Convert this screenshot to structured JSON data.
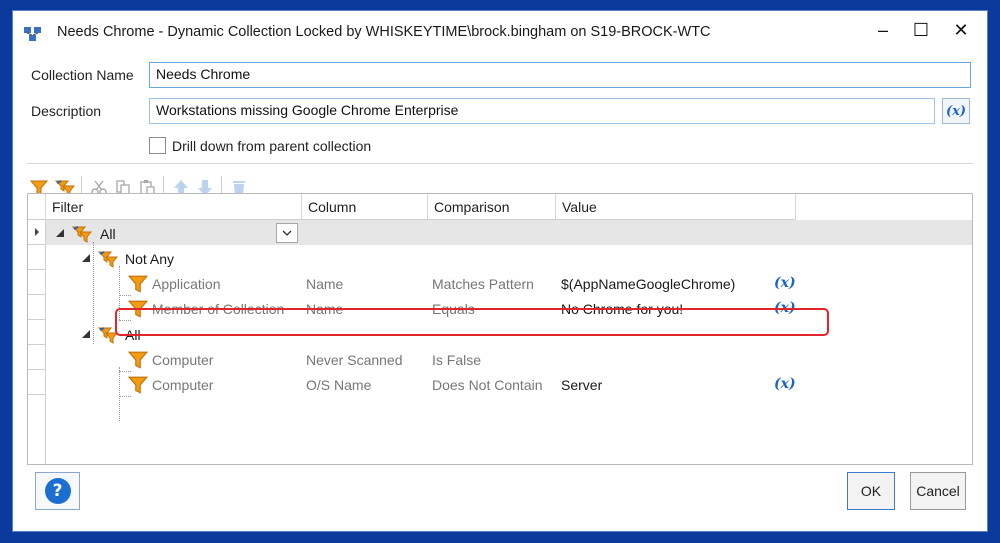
{
  "window": {
    "title": "Needs Chrome - Dynamic Collection Locked by WHISKEYTIME\\brock.bingham on S19-BROCK-WTC",
    "minimize": "–",
    "maximize": "☐",
    "close": "✕"
  },
  "form": {
    "collection_name_label": "Collection Name",
    "collection_name_value": "Needs Chrome",
    "description_label": "Description",
    "description_value": "Workstations missing Google Chrome Enterprise",
    "variable_button": "(x)",
    "drill_down_label": "Drill down from parent collection",
    "drill_down_checked": false
  },
  "toolbar": {
    "icons": [
      "add-filter-icon",
      "add-filter-group-icon",
      "cut-icon",
      "copy-icon",
      "paste-icon",
      "move-up-icon",
      "move-down-icon",
      "delete-icon"
    ]
  },
  "grid": {
    "headers": {
      "filter": "Filter",
      "column": "Column",
      "comparison": "Comparison",
      "value": "Value"
    },
    "rows": [
      {
        "filter": "All",
        "column": "",
        "comparison": "",
        "value": "",
        "variable": false
      },
      {
        "filter": "Not Any",
        "column": "",
        "comparison": "",
        "value": "",
        "variable": false
      },
      {
        "filter": "Application",
        "column": "Name",
        "comparison": "Matches Pattern",
        "value": "$(AppNameGoogleChrome)",
        "variable": true
      },
      {
        "filter": "Member of Collection",
        "column": "Name",
        "comparison": "Equals",
        "value": "No Chrome for you!",
        "variable": true
      },
      {
        "filter": "All",
        "column": "",
        "comparison": "",
        "value": "",
        "variable": false
      },
      {
        "filter": "Computer",
        "column": "Never Scanned",
        "comparison": "Is False",
        "value": "",
        "variable": false
      },
      {
        "filter": "Computer",
        "column": "O/S Name",
        "comparison": "Does Not Contain",
        "value": "Server",
        "variable": true
      }
    ],
    "variable_marker": "(x)"
  },
  "buttons": {
    "help": "?",
    "ok": "OK",
    "cancel": "Cancel"
  },
  "colors": {
    "background": "#0a3a9c",
    "accent": "#1b63c6",
    "funnel": "#f39c12",
    "highlight": "#e0262a"
  }
}
